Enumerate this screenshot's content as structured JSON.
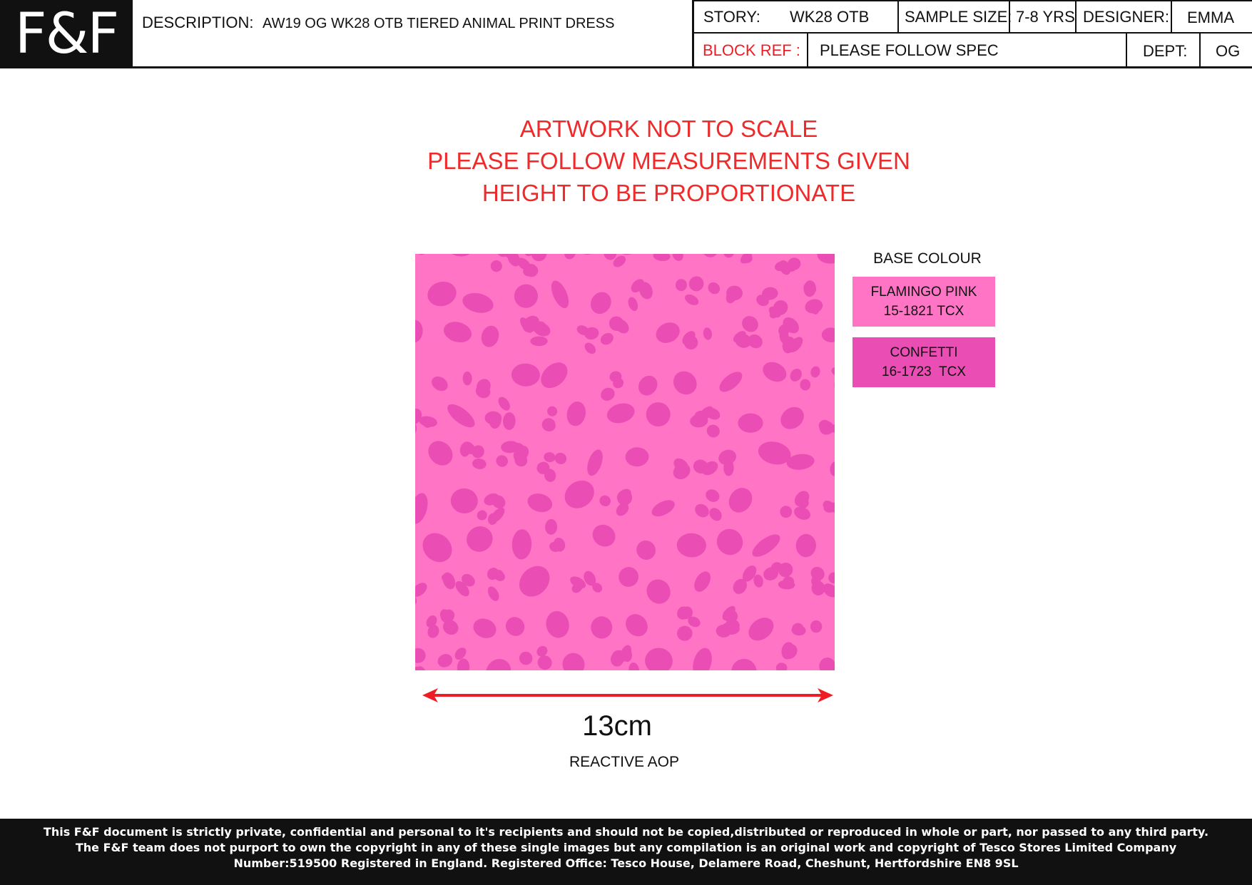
{
  "header": {
    "logo_text": "F&F",
    "description_label": "DESCRIPTION:",
    "description_value": "AW19 OG WK28 OTB TIERED ANIMAL PRINT DRESS",
    "story_label": "STORY:",
    "story_value": "WK28 OTB",
    "sample_size_label": "SAMPLE SIZE:",
    "sample_size_value": "7-8 YRS",
    "designer_label": "DESIGNER:",
    "designer_value": "EMMA",
    "block_ref_label": "BLOCK REF :",
    "block_ref_value": "PLEASE FOLLOW SPEC",
    "dept_label": "DEPT:",
    "dept_value": "OG"
  },
  "notice": {
    "line1": "ARTWORK NOT TO SCALE",
    "line2": "PLEASE FOLLOW MEASUREMENTS GIVEN",
    "line3": "HEIGHT TO BE PROPORTIONATE"
  },
  "artwork": {
    "base_color": "#ff74c4",
    "spot_color": "#ea4db4",
    "width_label": "13cm",
    "print_type": "REACTIVE AOP"
  },
  "colours": {
    "heading": "BASE COLOUR",
    "swatches": [
      {
        "name": "FLAMINGO PINK",
        "code": "15-1821 TCX",
        "color": "#ff74c4"
      },
      {
        "name": "CONFETTI",
        "code": "16-1723  TCX",
        "color": "#ea4db4"
      }
    ]
  },
  "footer": {
    "line1": "This F&F document is strictly private, confidential and personal to it's recipients and should not be copied,distributed or reproduced in whole or part, nor passed to any third party.",
    "line2": "The F&F team does not purport to own the copyright in any of these single images but any compilation is an original work and copyright of Tesco Stores Limited  Company",
    "line3": "Number:519500 Registered in England. Registered Office: Tesco House, Delamere Road, Cheshunt, Hertfordshire EN8 9SL"
  }
}
